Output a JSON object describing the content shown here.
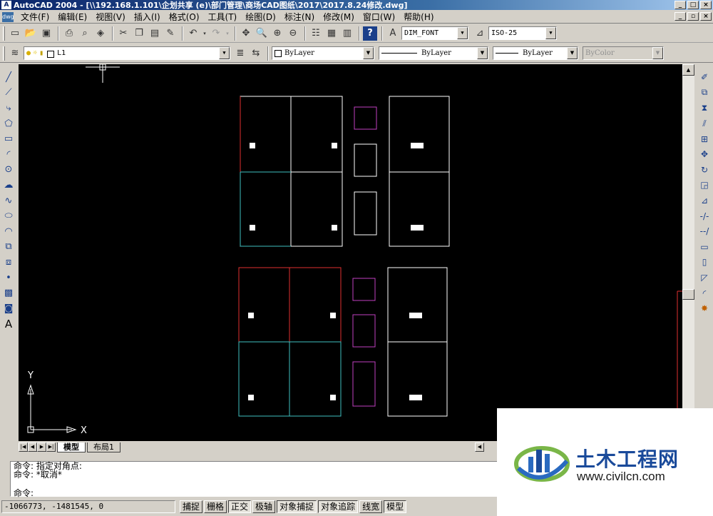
{
  "window": {
    "title": "AutoCAD 2004 - [\\\\192.168.1.101\\企划共享 (e)\\部门管理\\商场CAD图纸\\2017\\2017.8.24修改.dwg]",
    "app_icon": "autocad-icon",
    "controls": [
      "_",
      "□",
      "×"
    ]
  },
  "menu": {
    "items": [
      "文件(F)",
      "编辑(E)",
      "视图(V)",
      "插入(I)",
      "格式(O)",
      "工具(T)",
      "绘图(D)",
      "标注(N)",
      "修改(M)",
      "窗口(W)",
      "帮助(H)"
    ],
    "doc_controls": [
      "_",
      "▫",
      "×"
    ]
  },
  "standard_toolbar": {
    "text_style": "DIM_FONT",
    "dim_style": "ISO-25"
  },
  "layers_toolbar": {
    "layer": "L1",
    "color": "ByLayer",
    "linetype": "ByLayer",
    "lineweight": "ByLayer",
    "plotstyle": "ByColor"
  },
  "drawing": {
    "background": "#000000",
    "ucs_x_label": "X",
    "ucs_y_label": "Y",
    "colors": {
      "white": "#ffffff",
      "red": "#e03030",
      "cyan": "#40c0c0",
      "magenta": "#c040c0"
    }
  },
  "layout_tabs": {
    "tabs": [
      "模型",
      "布局1"
    ],
    "active": "模型"
  },
  "command": {
    "history": [
      "命令: 指定对角点:",
      "命令: *取消*"
    ],
    "prompt": "命令:"
  },
  "status": {
    "coordinates": "-1066773, -1481545, 0",
    "toggles": [
      {
        "label": "捕捉",
        "on": false
      },
      {
        "label": "栅格",
        "on": false
      },
      {
        "label": "正交",
        "on": true
      },
      {
        "label": "极轴",
        "on": false
      },
      {
        "label": "对象捕捉",
        "on": true
      },
      {
        "label": "对象追踪",
        "on": true
      },
      {
        "label": "线宽",
        "on": false
      },
      {
        "label": "模型",
        "on": true
      }
    ]
  },
  "watermark": {
    "title": "土木工程网",
    "url": "www.civilcn.com"
  }
}
